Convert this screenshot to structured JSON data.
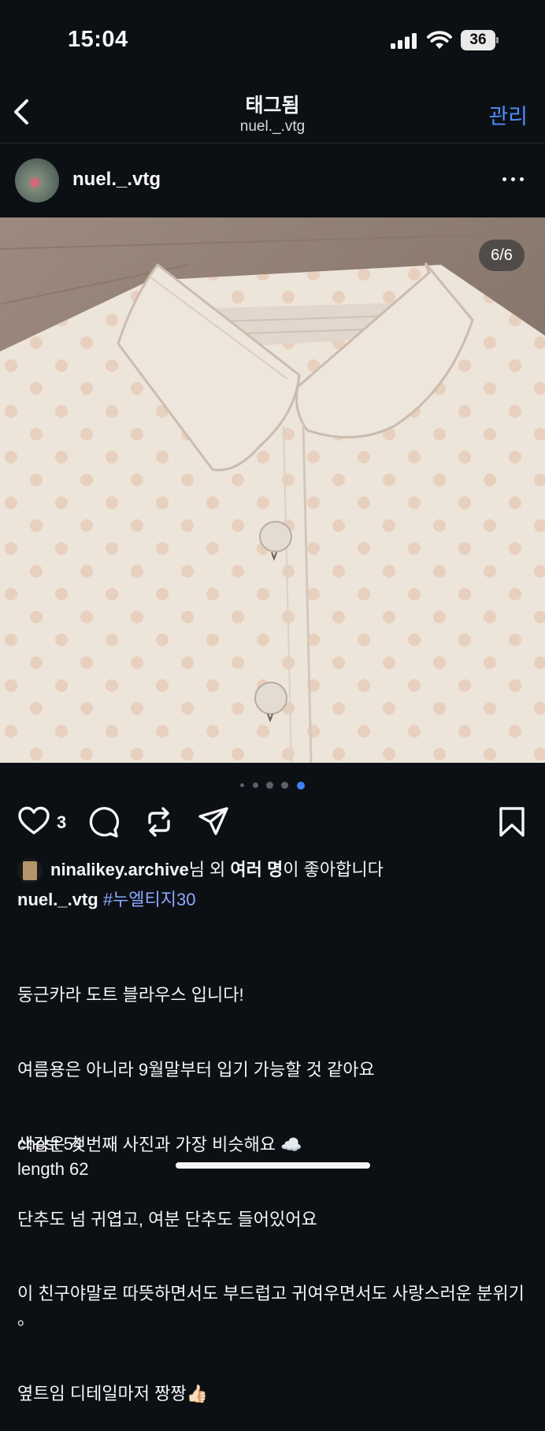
{
  "status_bar": {
    "time": "15:04",
    "battery": "36"
  },
  "nav": {
    "title": "태그됨",
    "subtitle": "nuel._.vtg",
    "manage": "관리"
  },
  "post": {
    "username": "nuel._.vtg",
    "counter": "6/6",
    "carousel": {
      "count": 5,
      "active": 4
    },
    "like_count": "3",
    "likes_user": "ninalikey.archive",
    "likes_text_1": "님 외 ",
    "likes_text_bold": "여러 명",
    "likes_text_2": "이 좋아합니다",
    "caption_username": "nuel._.vtg",
    "hashtag": "#누엘티지30",
    "caption_lines": [
      "둥근카라 도트 블라우스 입니다!",
      "여름용은 아니라 9월말부터 입기 가능할 것 같아요",
      "색감은 첫번째 사진과 가장 비슷해요 ☁️",
      "단추도 넘 귀엽고, 여분 단추도 들어있어요",
      "이 친구야말로 따뜻하면서도 부드럽고 귀여우면서도 사랑스러운 분위기 。",
      "옆트임 디테일마저 짱짱👍🏻"
    ],
    "measurements": [
      "chest 54",
      "length 62"
    ]
  },
  "colors": {
    "background": "#0c1014",
    "accent": "#4f8cff",
    "hashtag": "#8ba8ff"
  },
  "icons": [
    "back-chevron-icon",
    "more-icon",
    "heart-icon",
    "comment-icon",
    "repost-icon",
    "share-icon",
    "bookmark-icon"
  ]
}
